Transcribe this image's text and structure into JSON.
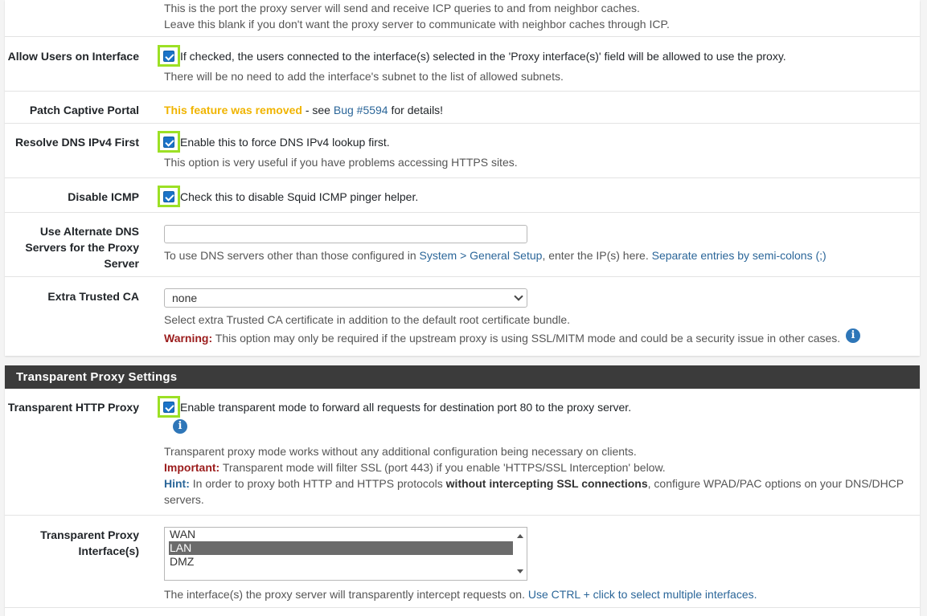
{
  "top_help": {
    "line1": "This is the port the proxy server will send and receive ICP queries to and from neighbor caches.",
    "line2": "Leave this blank if you don't want the proxy server to communicate with neighbor caches through ICP."
  },
  "allow_users": {
    "label": "Allow Users on Interface",
    "checkbox_text": "If checked, the users connected to the interface(s) selected in the 'Proxy interface(s)' field will be allowed to use the proxy.",
    "help": "There will be no need to add the interface's subnet to the list of allowed subnets."
  },
  "patch_captive": {
    "label": "Patch Captive Portal",
    "removed": "This feature was removed",
    "see": " - see ",
    "bug_link": "Bug #5594",
    "details": " for details!"
  },
  "resolve_dns": {
    "label": "Resolve DNS IPv4 First",
    "checkbox_text": "Enable this to force DNS IPv4 lookup first.",
    "help": "This option is very useful if you have problems accessing HTTPS sites."
  },
  "disable_icmp": {
    "label": "Disable ICMP",
    "checkbox_text": "Check this to disable Squid ICMP pinger helper."
  },
  "alt_dns": {
    "label_line1": "Use Alternate DNS",
    "label_line2": "Servers for the Proxy",
    "label_line3": "Server",
    "value": "",
    "help_prefix": "To use DNS servers other than those configured in ",
    "help_link": "System > General Setup",
    "help_mid": ", enter the IP(s) here. ",
    "help_link2": "Separate entries by semi-colons (;)"
  },
  "extra_ca": {
    "label": "Extra Trusted CA",
    "selected": "none",
    "help": "Select extra Trusted CA certificate in addition to the default root certificate bundle.",
    "warning_label": "Warning:",
    "warning_text": " This option may only be required if the upstream proxy is using SSL/MITM mode and could be a security issue in other cases."
  },
  "transparent_section": {
    "title": "Transparent Proxy Settings"
  },
  "transparent_http": {
    "label": "Transparent HTTP Proxy",
    "checkbox_text": "Enable transparent mode to forward all requests for destination port 80 to the proxy server.",
    "help": "Transparent proxy mode works without any additional configuration being necessary on clients.",
    "important_label": "Important:",
    "important_text": " Transparent mode will filter SSL (port 443) if you enable 'HTTPS/SSL Interception' below.",
    "hint_label": "Hint:",
    "hint_text1": " In order to proxy both HTTP and HTTPS protocols ",
    "hint_bold": "without intercepting SSL connections",
    "hint_text2": ", configure WPAD/PAC options on your DNS/DHCP",
    "hint_text3": "servers."
  },
  "transparent_iface": {
    "label_line1": "Transparent Proxy",
    "label_line2": "Interface(s)",
    "options": [
      "WAN",
      "LAN",
      "DMZ"
    ],
    "selected": "LAN",
    "help_prefix": "The interface(s) the proxy server will transparently intercept requests on. ",
    "help_link": "Use CTRL + click to select multiple interfaces."
  },
  "icons": {
    "info": "info-icon",
    "check": "checkbox-checked-icon",
    "select_arrow": "chevron-down-icon"
  },
  "colors": {
    "highlight": "#9ce025",
    "checkbox": "#1a73c8",
    "section_header": "#3b3b3b",
    "link": "#2b6699",
    "warning": "#9b1c1c",
    "removed": "#f0b400"
  }
}
